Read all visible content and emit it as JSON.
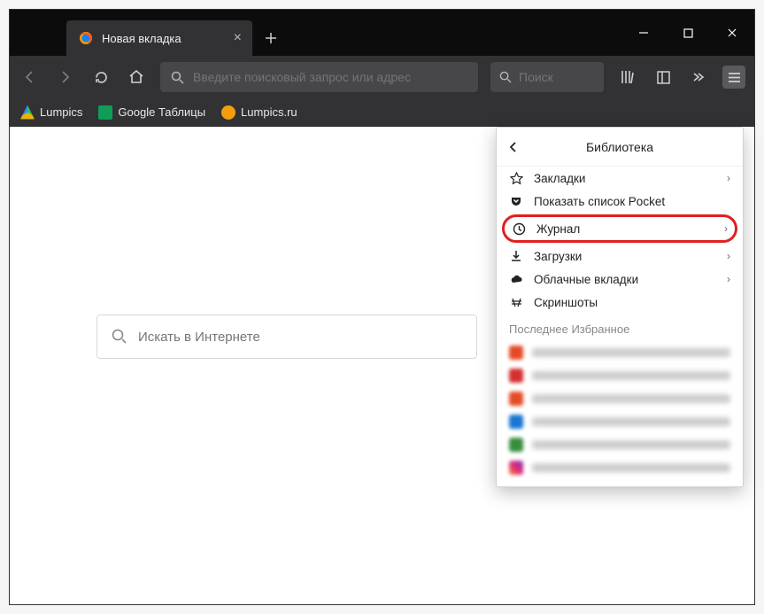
{
  "tab": {
    "title": "Новая вкладка"
  },
  "urlbar": {
    "placeholder": "Введите поисковый запрос или адрес"
  },
  "searchbox": {
    "placeholder": "Поиск"
  },
  "bookmarkbar": {
    "items": [
      {
        "label": "Lumpics",
        "color": "linear-gradient(135deg,#22c55e 33%,#eab308 33%,#eab308 66%,#3b82f6 66%)"
      },
      {
        "label": "Google Таблицы",
        "color": "#0f9d58"
      },
      {
        "label": "Lumpics.ru",
        "color": "#f59e0b"
      }
    ]
  },
  "homesearch": {
    "placeholder": "Искать в Интернете"
  },
  "menu": {
    "title": "Библиотека",
    "items": {
      "bookmarks": "Закладки",
      "pocket": "Показать список Pocket",
      "history": "Журнал",
      "downloads": "Загрузки",
      "synced": "Облачные вкладки",
      "screenshots": "Скриншоты"
    },
    "recent_section": "Последнее Избранное",
    "recent_colors": [
      "#e34c26",
      "#d32f2f",
      "#e34c26",
      "#1976d2",
      "#388e3c",
      "linear-gradient(45deg,#f58529,#dd2a7b,#8134af)"
    ]
  }
}
